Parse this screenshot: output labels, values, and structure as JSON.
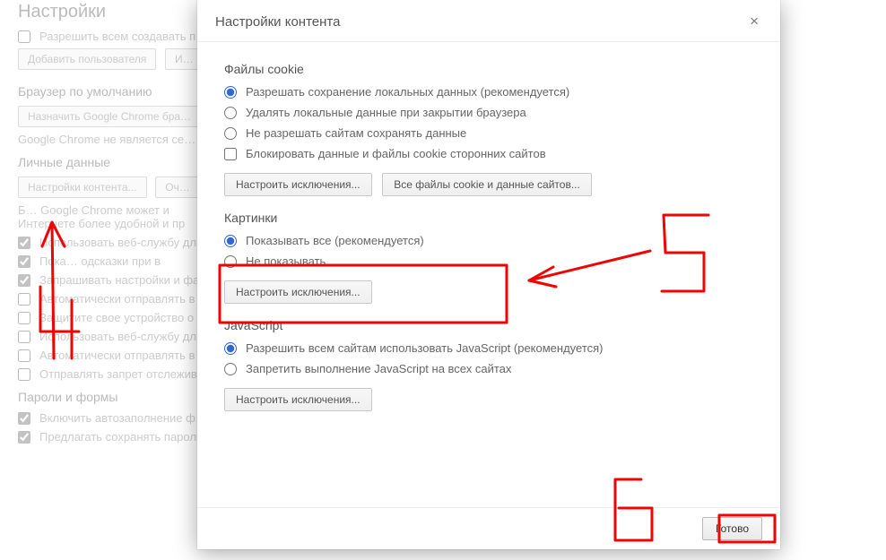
{
  "bg": {
    "page_title": "Настройки",
    "users": {
      "allow_all": "Разрешить всем создавать п…",
      "add_user_btn": "Добавить пользователя",
      "import_btn": "И…"
    },
    "default_browser": {
      "title": "Браузер по умолчанию",
      "set_btn": "Назначить Google Chrome бра…",
      "note": "Google Chrome не является се…"
    },
    "privacy": {
      "title": "Личные данные",
      "content_btn": "Настройки контента...",
      "clear_btn": "Оч…",
      "note1": "Б…   Google Chrome может и",
      "note2": "Интернете более удобной и пр",
      "opt1": "Использовать веб-службу дл",
      "opt2": "Пока…         одсказки при в",
      "opt3": "Запрашивать настройки и фа",
      "opt4": "Автоматически отправлять в",
      "opt5": "Защитите свое устройство о",
      "opt6": "Использовать веб-службу дл",
      "opt7": "Автоматически отправлять в",
      "opt8": "Отправлять запрет отслежива"
    },
    "passwords": {
      "title": "Пароли и формы",
      "opt1": "Включить автозаполнение ф",
      "opt2": "Предлагать сохранять пароли для сайтов Настроить"
    }
  },
  "dialog": {
    "title": "Настройки контента",
    "close_aria": "Закрыть",
    "cookies": {
      "title": "Файлы cookie",
      "r1": "Разрешать сохранение локальных данных (рекомендуется)",
      "r2": "Удалять локальные данные при закрытии браузера",
      "r3": "Не разрешать сайтам сохранять данные",
      "cb": "Блокировать данные и файлы cookie сторонних сайтов",
      "btn1": "Настроить исключения...",
      "btn2": "Все файлы cookie и данные сайтов..."
    },
    "images": {
      "title": "Картинки",
      "r1": "Показывать все (рекомендуется)",
      "r2": "Не показывать",
      "btn": "Настроить исключения..."
    },
    "js": {
      "title": "JavaScript",
      "r1": "Разрешить всем сайтам использовать JavaScript (рекомендуется)",
      "r2": "Запретить выполнение JavaScript на всех сайтах",
      "btn": "Настроить исключения..."
    },
    "done_btn": "Готово"
  },
  "annotations": {
    "label4": "4",
    "label5": "5",
    "label6": "6"
  }
}
